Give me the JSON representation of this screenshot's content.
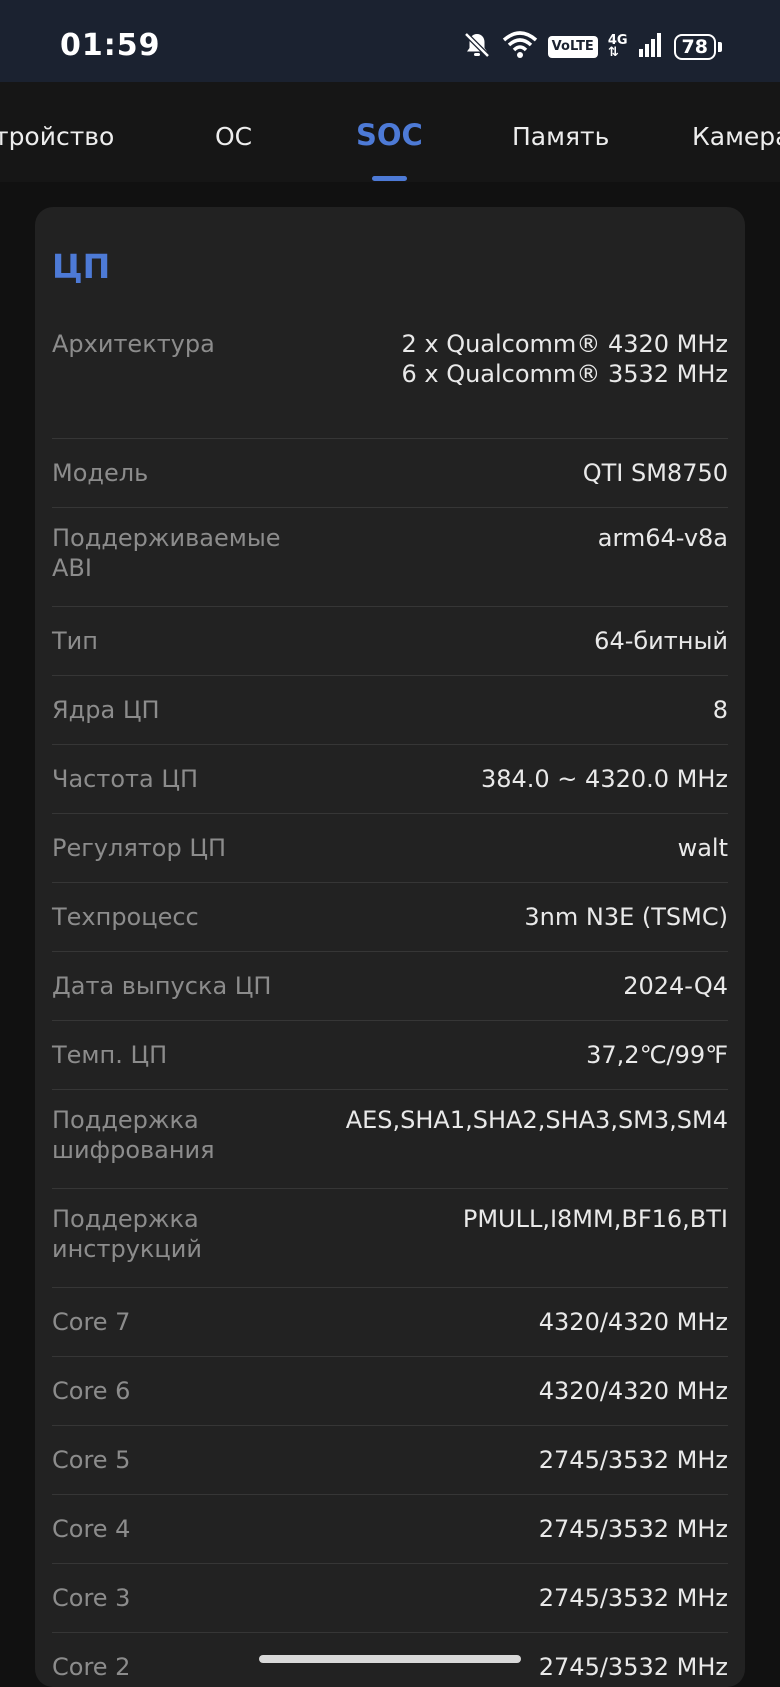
{
  "status_bar": {
    "time": "01:59",
    "volte": "VoLTE",
    "network": "4G",
    "battery": "78"
  },
  "tabs": [
    {
      "label": "тройство"
    },
    {
      "label": "ОС"
    },
    {
      "label": "SOC"
    },
    {
      "label": "Память"
    },
    {
      "label": "Камера"
    }
  ],
  "active_tab": "SOC",
  "accent_color": "#4d7ad6",
  "section": {
    "title": "ЦП",
    "architecture": {
      "label": "Архитектура",
      "line1": "2 x Qualcomm® 4320 MHz",
      "line2": "6 x Qualcomm® 3532 MHz"
    },
    "rows": [
      {
        "label": "Модель",
        "value": "QTI SM8750"
      },
      {
        "label": "Поддерживаемые ABI",
        "value": "arm64-v8a"
      },
      {
        "label": "Тип",
        "value": "64-битный"
      },
      {
        "label": "Ядра ЦП",
        "value": "8"
      },
      {
        "label": "Частота ЦП",
        "value": "384.0 ~ 4320.0 MHz"
      },
      {
        "label": "Регулятор ЦП",
        "value": "walt"
      },
      {
        "label": "Техпроцесс",
        "value": "3nm N3E (TSMC)"
      },
      {
        "label": "Дата выпуска ЦП",
        "value": "2024-Q4"
      },
      {
        "label": "Темп. ЦП",
        "value": "37,2℃/99℉"
      },
      {
        "label": "Поддержка шифрования",
        "value": "AES,SHA1,SHA2,SHA3,SM3,SM4"
      },
      {
        "label": "Поддержка инструкций",
        "value": "PMULL,I8MM,BF16,BTI"
      },
      {
        "label": "Core 7",
        "value": "4320/4320 MHz"
      },
      {
        "label": "Core 6",
        "value": "4320/4320 MHz"
      },
      {
        "label": "Core 5",
        "value": "2745/3532 MHz"
      },
      {
        "label": "Core 4",
        "value": "2745/3532 MHz"
      },
      {
        "label": "Core 3",
        "value": "2745/3532 MHz"
      },
      {
        "label": "Core 2",
        "value": "2745/3532 MHz"
      }
    ]
  }
}
